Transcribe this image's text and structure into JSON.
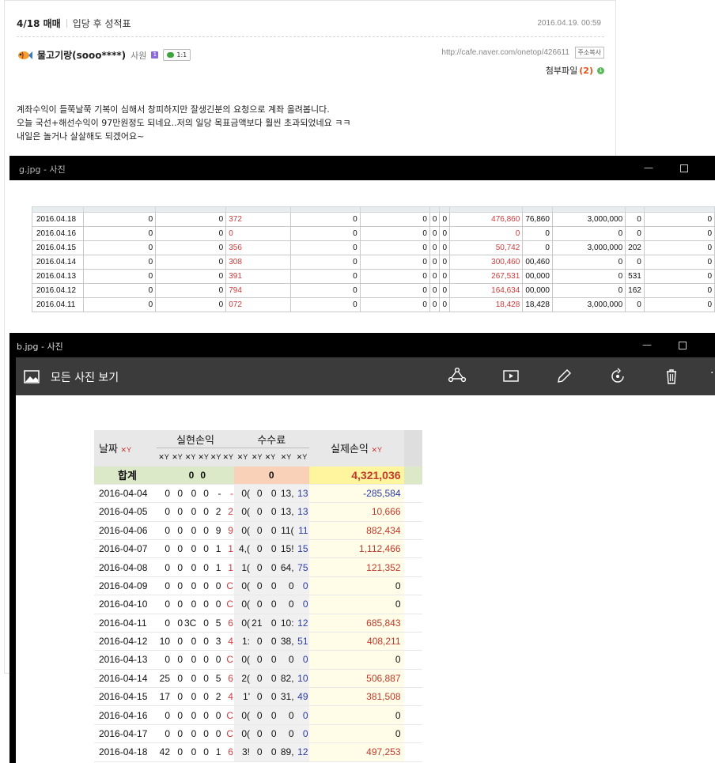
{
  "post": {
    "title": "4/18 매매",
    "category": "입당 후 성적표",
    "date": "2016.04.19. 00:59",
    "author": "물고기랑(sooo****)",
    "rank": "사원",
    "rank_badge": "1",
    "chat_label": "1:1",
    "url": "http://cafe.naver.com/onetop/426611",
    "copy_label": "주소복사",
    "attach_label": "첨부파일",
    "attach_count": "(2)",
    "lines": [
      "계좌수익이 들쭉날쭉 기복이 심해서 창피하지만 잘생긴분의 요청으로 계좌 올려봅니다.",
      "오늘 국선+해선수익이 97만원정도 되네요..저의 일당 목표금액보다 훨씬 초과되었네요 ㅋㅋ",
      "내일은 놀거나 살살해도 되겠어요~"
    ]
  },
  "win_g": {
    "title": "g.jpg - 사진",
    "rows": [
      [
        "2016.04.18",
        "0",
        "0",
        "372",
        "0",
        "0",
        "0",
        "0",
        "476,860",
        "76,860",
        "3,000,000",
        "0",
        "0"
      ],
      [
        "2016.04.16",
        "0",
        "0",
        "0",
        "0",
        "0",
        "0",
        "0",
        "0",
        "0",
        "0",
        "0",
        "0"
      ],
      [
        "2016.04.15",
        "0",
        "0",
        "356",
        "0",
        "0",
        "0",
        "0",
        "50,742",
        "0",
        "3,000,000",
        "202",
        "0"
      ],
      [
        "2016.04.14",
        "0",
        "0",
        "308",
        "0",
        "0",
        "0",
        "0",
        "300,460",
        "00,460",
        "0",
        "0",
        "0"
      ],
      [
        "2016.04.13",
        "0",
        "0",
        "391",
        "0",
        "0",
        "0",
        "0",
        "267,531",
        "00,000",
        "0",
        "531",
        "0"
      ],
      [
        "2016.04.12",
        "0",
        "0",
        "794",
        "0",
        "0",
        "0",
        "0",
        "164,634",
        "00,000",
        "0",
        "162",
        "0"
      ],
      [
        "2016.04.11",
        "0",
        "0",
        "072",
        "0",
        "0",
        "0",
        "0",
        "18,428",
        "18,428",
        "3,000,000",
        "0",
        "0"
      ]
    ]
  },
  "win_b": {
    "title": "b.jpg - 사진",
    "toolbar_title": "모든 사진 보기",
    "header": {
      "date": "날짜",
      "realized": "실현손익",
      "fee": "수수료",
      "net": "실제손익"
    },
    "total": {
      "label": "합계",
      "c1": "0",
      "c2": "0",
      "fee": "0",
      "net": "4,321,036"
    },
    "rows": [
      [
        "2016-04-04",
        "0",
        "0",
        "0",
        "0",
        "-",
        "-",
        "0(",
        "0",
        "0",
        "13,",
        "13",
        "-285,584"
      ],
      [
        "2016-04-05",
        "0",
        "0",
        "0",
        "0",
        "2",
        "2",
        "0(",
        "0",
        "0",
        "13,",
        "13",
        "10,666"
      ],
      [
        "2016-04-06",
        "0",
        "0",
        "0",
        "0",
        "9",
        "9",
        "0(",
        "0",
        "0",
        "11(",
        "11",
        "882,434"
      ],
      [
        "2016-04-07",
        "0",
        "0",
        "0",
        "0",
        "1",
        "1",
        "4,(",
        "0",
        "0",
        "15!",
        "15",
        "1,112,466"
      ],
      [
        "2016-04-08",
        "0",
        "0",
        "0",
        "0",
        "1",
        "1",
        "1(",
        "0",
        "0",
        "64,",
        "75",
        "121,352"
      ],
      [
        "2016-04-09",
        "0",
        "0",
        "0",
        "0",
        "0",
        "C",
        "0(",
        "0",
        "0",
        "0",
        "0",
        "0"
      ],
      [
        "2016-04-10",
        "0",
        "0",
        "0",
        "0",
        "0",
        "C",
        "0(",
        "0",
        "0",
        "0",
        "0",
        "0"
      ],
      [
        "2016-04-11",
        "0",
        "0",
        "3C",
        "0",
        "5",
        "6",
        "0(",
        "21",
        "0",
        "10:",
        "12",
        "685,843"
      ],
      [
        "2016-04-12",
        "10",
        "0",
        "0",
        "0",
        "3",
        "4",
        "1:",
        "0",
        "0",
        "38,",
        "51",
        "408,211"
      ],
      [
        "2016-04-13",
        "0",
        "0",
        "0",
        "0",
        "0",
        "C",
        "0(",
        "0",
        "0",
        "0",
        "0",
        "0"
      ],
      [
        "2016-04-14",
        "25",
        "0",
        "0",
        "0",
        "5",
        "6",
        "2(",
        "0",
        "0",
        "82,",
        "10",
        "506,887"
      ],
      [
        "2016-04-15",
        "17",
        "0",
        "0",
        "0",
        "2",
        "4",
        "1'",
        "0",
        "0",
        "31,",
        "49",
        "381,508"
      ],
      [
        "2016-04-16",
        "0",
        "0",
        "0",
        "0",
        "0",
        "C",
        "0(",
        "0",
        "0",
        "0",
        "0",
        "0"
      ],
      [
        "2016-04-17",
        "0",
        "0",
        "0",
        "0",
        "0",
        "C",
        "0(",
        "0",
        "0",
        "0",
        "0",
        "0"
      ],
      [
        "2016-04-18",
        "42",
        "0",
        "0",
        "0",
        "1",
        "6",
        "3!",
        "0",
        "0",
        "89,",
        "12",
        "497,253"
      ]
    ]
  }
}
